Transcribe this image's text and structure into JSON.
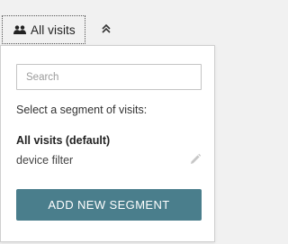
{
  "segment_selector": {
    "current_label": "All visits",
    "icon": "users-icon",
    "collapse_icon": "chevron-double-up-icon"
  },
  "panel": {
    "search": {
      "placeholder": "Search",
      "value": ""
    },
    "prompt": "Select a segment of visits:",
    "segments": [
      {
        "label": "All visits (default)",
        "selected": true,
        "editable": false
      },
      {
        "label": "device filter",
        "selected": false,
        "editable": true,
        "edit_icon": "pencil-icon"
      }
    ],
    "add_button_label": "ADD NEW SEGMENT"
  },
  "colors": {
    "accent": "#4a7e8c",
    "page_background": "#f1f1f1",
    "panel_background": "#ffffff"
  }
}
